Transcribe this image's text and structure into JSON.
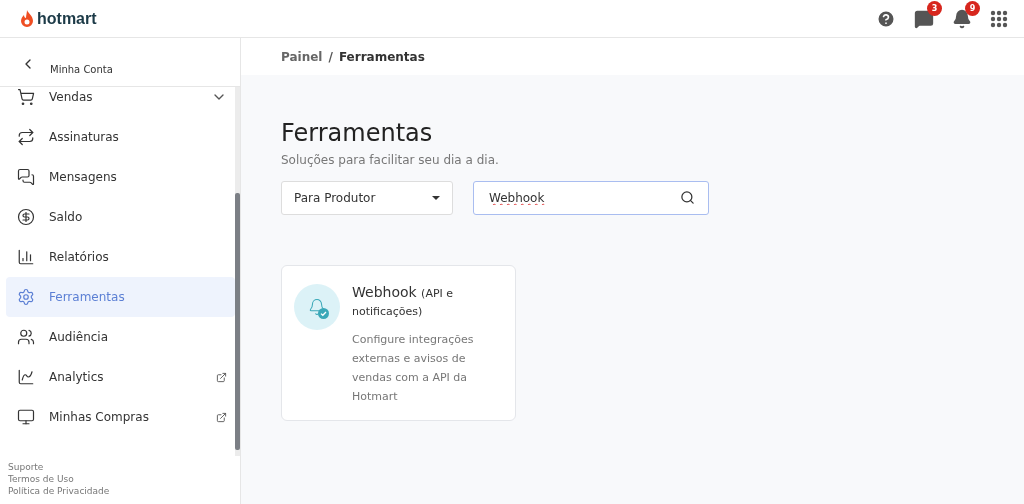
{
  "header": {
    "logo": "hotmart",
    "chat_badge": "3",
    "notification_badge": "9"
  },
  "sidebar": {
    "back_label": "Minha Conta",
    "items": [
      {
        "label": "Vendas",
        "selected": false,
        "kind": "expandable"
      },
      {
        "label": "Assinaturas",
        "selected": false,
        "kind": "plain"
      },
      {
        "label": "Mensagens",
        "selected": false,
        "kind": "plain"
      },
      {
        "label": "Saldo",
        "selected": false,
        "kind": "plain"
      },
      {
        "label": "Relatórios",
        "selected": false,
        "kind": "plain"
      },
      {
        "label": "Ferramentas",
        "selected": true,
        "kind": "plain"
      },
      {
        "label": "Audiência",
        "selected": false,
        "kind": "plain"
      },
      {
        "label": "Analytics",
        "selected": false,
        "kind": "external"
      },
      {
        "label": "Minhas Compras",
        "selected": false,
        "kind": "external"
      }
    ],
    "footer_links": [
      "Suporte",
      "Termos de Uso",
      "Política de Privacidade"
    ]
  },
  "breadcrumb": {
    "separator": "/",
    "items": [
      "Painel",
      "Ferramentas"
    ]
  },
  "page": {
    "title": "Ferramentas",
    "subtitle": "Soluções para facilitar seu dia a dia.",
    "filter": {
      "value": "Para Produtor"
    },
    "search": {
      "value": "Webhook"
    },
    "cards": [
      {
        "title": "Webhook",
        "title_suffix": "(API e notificações)",
        "description": "Configure integrações externas e avisos de vendas com a API da Hotmart"
      }
    ]
  }
}
